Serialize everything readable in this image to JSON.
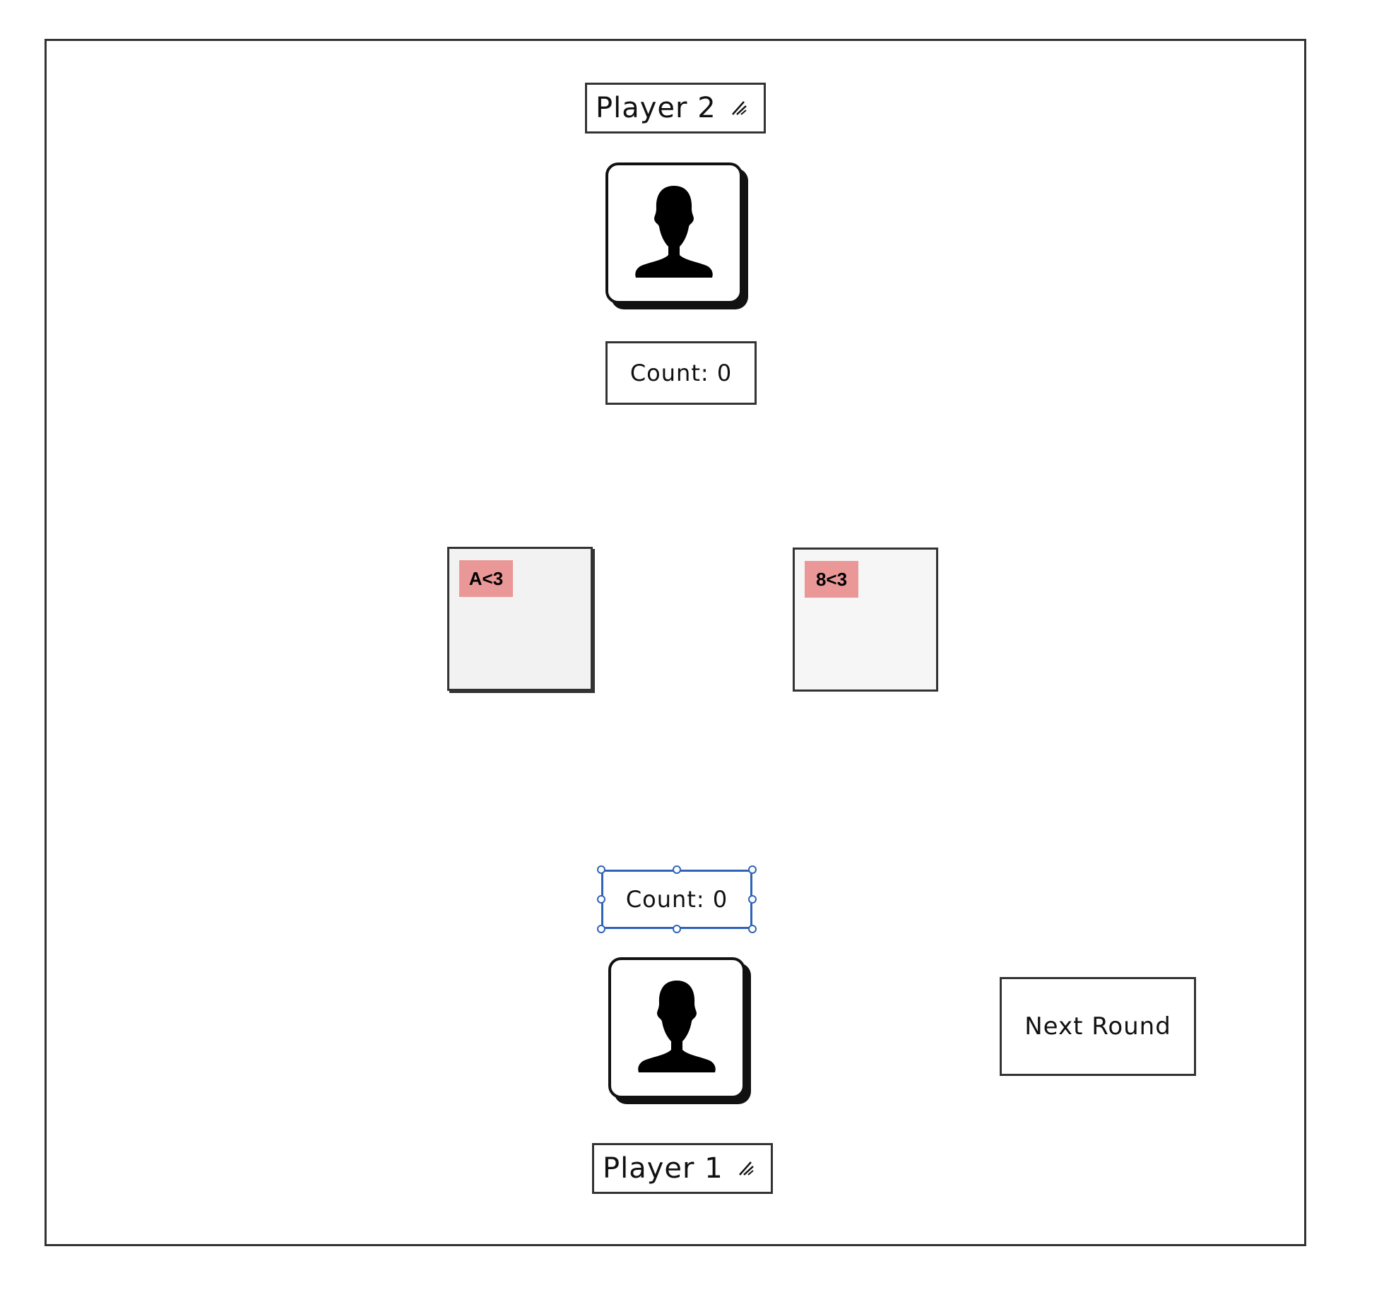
{
  "players": {
    "top": {
      "name": "Player 2",
      "count_text": "Count: 0",
      "edit_icon": "edit-icon",
      "avatar_icon": "person-silhouette-icon"
    },
    "bottom": {
      "name": "Player 1",
      "count_text": "Count: 0",
      "edit_icon": "edit-icon",
      "avatar_icon": "person-silhouette-icon"
    }
  },
  "cards": {
    "left": {
      "label": "A<3"
    },
    "right": {
      "label": "8<3"
    }
  },
  "actions": {
    "next_round_label": "Next Round"
  },
  "colors": {
    "card_tag": "#ea9797",
    "selection": "#2e63b8",
    "card_bg": "#f2f2f2"
  }
}
